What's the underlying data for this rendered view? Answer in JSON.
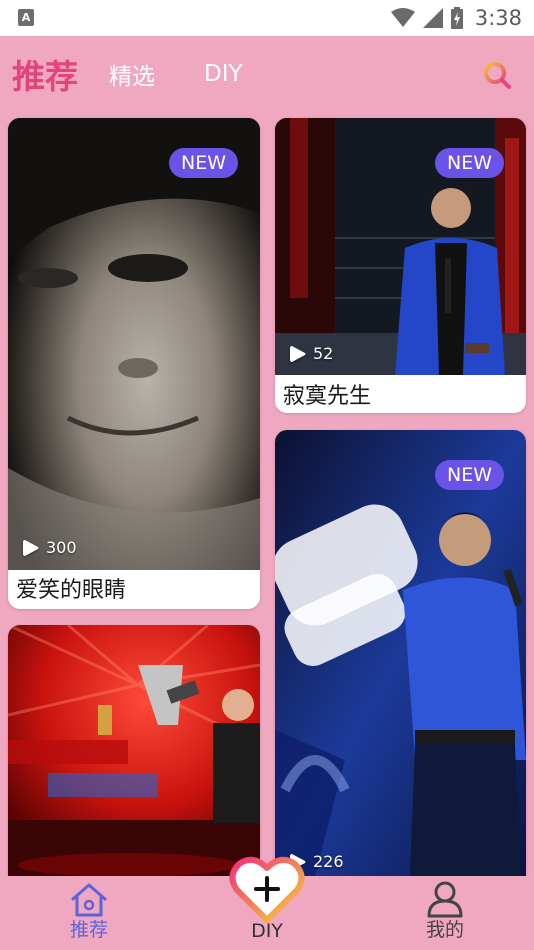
{
  "status_bar": {
    "time": "3:38",
    "notification_icon": "A"
  },
  "header": {
    "tabs": [
      {
        "label": "推荐",
        "active": true
      },
      {
        "label": "精选",
        "active": false
      },
      {
        "label": "DIY",
        "active": false
      }
    ],
    "search_icon": "search-icon"
  },
  "feed": {
    "cards": [
      {
        "badge": "NEW",
        "plays": "300",
        "title": "爱笑的眼睛"
      },
      {
        "badge": "NEW",
        "plays": "52",
        "title": "寂寞先生"
      },
      {
        "badge": "",
        "plays": "",
        "title": ""
      },
      {
        "badge": "NEW",
        "plays": "226",
        "title": ""
      }
    ]
  },
  "bottom_nav": {
    "home_label": "推荐",
    "diy_label": "DIY",
    "me_label": "我的"
  },
  "colors": {
    "background": "#f0a7c0",
    "accent": "#e2457a",
    "badge": "#6b53e8",
    "nav_active": "#5e63d9"
  }
}
